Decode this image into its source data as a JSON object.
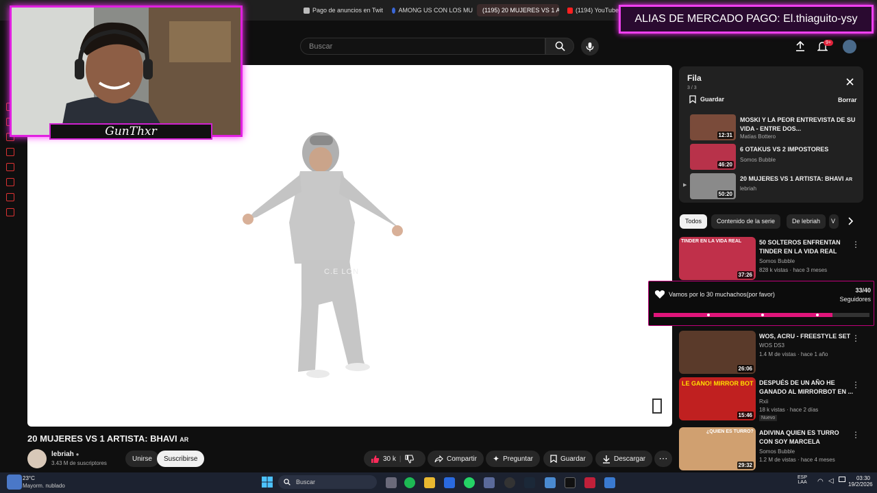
{
  "tabs": [
    {
      "label": "Pago de anuncios en Twit",
      "color": "#bbbbbb"
    },
    {
      "label": "AMONG US CON LOS MU",
      "color": "#3a66d6"
    },
    {
      "label": "(1195) 20 MUJERES VS 1 A",
      "color": "#ff2020"
    },
    {
      "label": "(1194) YouTube",
      "color": "#ff2020"
    }
  ],
  "overlay": {
    "cam_name": "GunThxr",
    "alias_text": "ALIAS DE MERCADO PAGO: El.thiaguito-ysy"
  },
  "header": {
    "search_placeholder": "Buscar",
    "notif_count": "9+"
  },
  "player": {
    "watermark": "C.E LON"
  },
  "queue": {
    "title": "Fila",
    "position": "3 / 3",
    "save_label": "Guardar",
    "clear_label": "Borrar",
    "items": [
      {
        "title": "MOSKI Y LA PEOR ENTREVISTA DE SU VIDA - ENTRE DOS...",
        "channel": "Matías Bottero",
        "duration": "12:31",
        "thumb": "#7a4b3a"
      },
      {
        "title": "6 OTAKUS VS 2 IMPOSTORES",
        "channel": "Somos Bubble",
        "duration": "46:20",
        "thumb": "#b8324a"
      },
      {
        "title": "20 MUJERES VS 1 ARTISTA: BHAVI",
        "channel": "lebriah",
        "duration": "50:20",
        "thumb": "#8a8a8a",
        "badge": "AR"
      }
    ]
  },
  "chips": [
    "Todos",
    "Contenido de la serie",
    "De lebriah",
    "V"
  ],
  "recommended": [
    {
      "title": "50 SOLTEROS ENFRENTAN TINDER EN LA VIDA REAL",
      "channel": "Somos Bubble",
      "meta": "828 k vistas · hace 3 meses",
      "duration": "37:26",
      "thumb": "#c0304a",
      "overlay": "TINDER EN LA VIDA REAL"
    },
    {
      "title": "WOS, ACRU - FREESTYLE SET",
      "channel": "WOS DS3",
      "meta": "1.4 M de vistas · hace 1 año",
      "duration": "26:06",
      "thumb": "#5a3a2a",
      "overlay": ""
    },
    {
      "title": "DESPUÉS DE UN AÑO HE GANADO AL MIRRORBOT EN ...",
      "channel": "Rxii",
      "meta": "18 k vistas · hace 2 días",
      "badge": "Nuevo",
      "duration": "15:46",
      "thumb": "#c02020",
      "overlay": "LE GANO! MIRROR BOT"
    },
    {
      "title": "ADIVINA QUIEN ES TURRO CON SOY MARCELA",
      "channel": "Somos Bubble",
      "meta": "1.2 M de vistas · hace 4 meses",
      "duration": "29:32",
      "thumb": "#d0a070",
      "overlay": "¿QUIEN ES TURRO?"
    }
  ],
  "goal": {
    "text": "Vamos por lo 30 muchachos(por favor)",
    "count": "33/40",
    "label": "Seguidores",
    "progress": 0.83
  },
  "video": {
    "title": "20 MUJERES VS 1 ARTISTA: BHAVI",
    "title_badge": "AR",
    "channel": "lebriah",
    "subs": "3.43 M de suscriptores",
    "join": "Unirse",
    "subscribe": "Suscribirse",
    "likes": "30 k",
    "share": "Compartir",
    "ask": "Preguntar",
    "save": "Guardar",
    "download": "Descargar"
  },
  "taskbar": {
    "temp": "23°C",
    "weather": "Mayorm. nublado",
    "search": "Buscar",
    "lang1": "ESP",
    "lang2": "LAA",
    "time": "03:30",
    "date": "19/2/2026"
  },
  "colors": {
    "accent": "#ff30ff",
    "goal_bar": "#e0157a"
  }
}
